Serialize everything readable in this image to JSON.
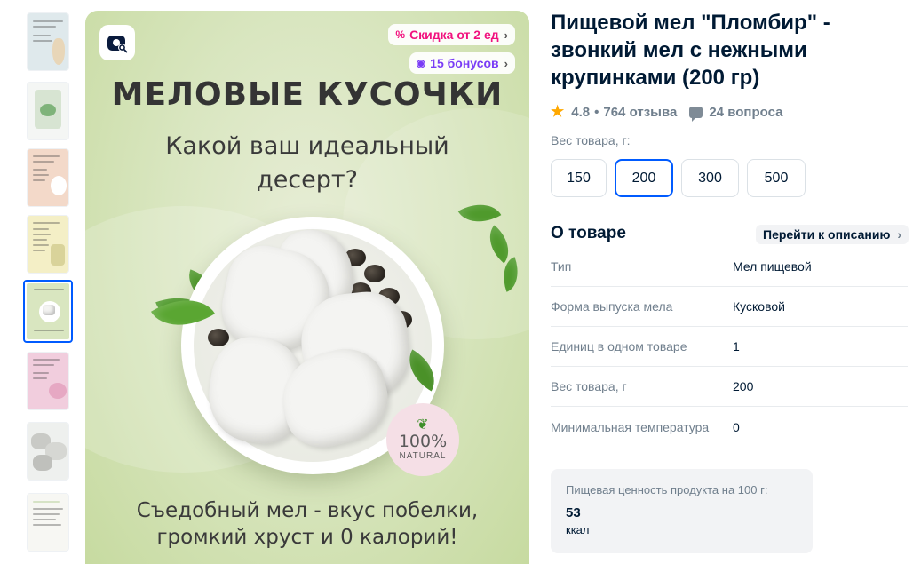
{
  "thumbnails": [
    {
      "id": "thumb-1",
      "bg": "#dfe9ec",
      "accent": "#e8d6b8"
    },
    {
      "id": "thumb-2",
      "bg": "#f4f6f4",
      "accent": "#7fb37a"
    },
    {
      "id": "thumb-3",
      "bg": "#f3d9c9",
      "accent": "#e5b8a2"
    },
    {
      "id": "thumb-4",
      "bg": "#f4efc6",
      "accent": "#d9d39a"
    },
    {
      "id": "thumb-5",
      "bg": "#d9e6c0",
      "accent": "#f4f4f2",
      "active": true
    },
    {
      "id": "thumb-6",
      "bg": "#f1cddd",
      "accent": "#e6a8c3"
    },
    {
      "id": "thumb-7",
      "bg": "#eef0ee",
      "accent": "#c9cac6"
    },
    {
      "id": "thumb-8",
      "bg": "#f7f7f3",
      "accent": "#d6e3c6"
    }
  ],
  "image": {
    "discount_pill": "Скидка от 2 ед",
    "bonus_pill": "15 бонусов",
    "headline": "МЕЛОВЫЕ КУСОЧКИ",
    "question": "Какой ваш идеальный десерт?",
    "badge_percent": "100%",
    "badge_text": "NATURAL",
    "bottom_text": "Съедобный мел - вкус побелки, громкий хруст и 0 калорий!"
  },
  "product": {
    "title": "Пищевой мел \"Пломбир\" - звонкий мел с нежными крупинками (200 гр)",
    "rating": "4.8",
    "separator": "•",
    "reviews": "764 отзыва",
    "questions": "24 вопроса"
  },
  "weight": {
    "label": "Вес товара, г:",
    "options": [
      "150",
      "200",
      "300",
      "500"
    ],
    "selected": "200"
  },
  "about": {
    "title": "О товаре",
    "link": "Перейти к описанию",
    "specs": [
      {
        "key": "Тип",
        "value": "Мел пищевой"
      },
      {
        "key": "Форма выпуска мела",
        "value": "Кусковой"
      },
      {
        "key": "Единиц в одном товаре",
        "value": "1"
      },
      {
        "key": "Вес товара, г",
        "value": "200"
      },
      {
        "key": "Минимальная температура",
        "value": "0"
      }
    ]
  },
  "nutrition": {
    "label": "Пищевая ценность продукта на 100 г:",
    "value": "53",
    "unit": "ккал"
  },
  "colors": {
    "accent_blue": "#005bff",
    "discount_pink": "#f1117e",
    "bonus_purple": "#7a3cf6",
    "star": "#ffa800",
    "muted_text": "#707f8d"
  }
}
